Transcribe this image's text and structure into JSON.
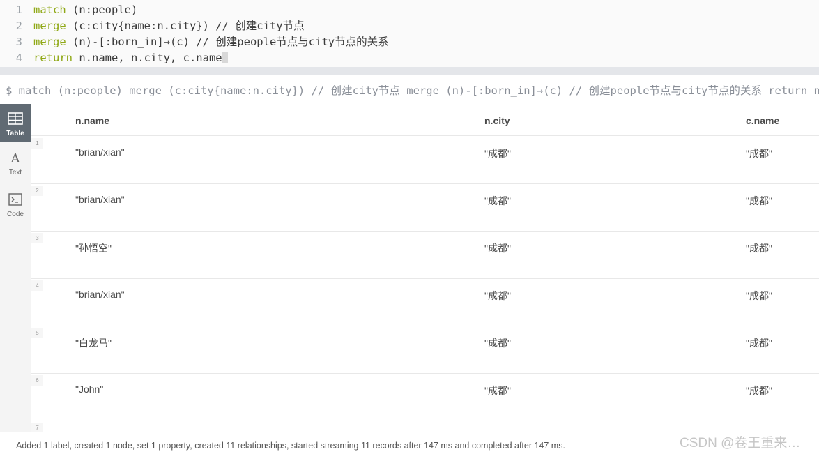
{
  "editor": {
    "lines": [
      {
        "num": "1",
        "kw": "match",
        "rest": " (n:people)"
      },
      {
        "num": "2",
        "kw": "merge",
        "rest": " (c:city{name:n.city}) // 创建city节点"
      },
      {
        "num": "3",
        "kw": "merge",
        "rest": " (n)-[:born_in]→(c) // 创建people节点与city节点的关系"
      },
      {
        "num": "4",
        "kw": "return",
        "rest": " n.name, n.city, c.name"
      }
    ]
  },
  "summary": {
    "text": "$ match (n:people) merge (c:city{name:n.city}) // 创建city节点 merge (n)-[:born_in]→(c) // 创建people节点与city节点的关系 return n.n"
  },
  "sidebar": {
    "tabs": [
      {
        "label": "Table",
        "icon": "table-icon",
        "active": true
      },
      {
        "label": "Text",
        "icon": "text-icon",
        "active": false
      },
      {
        "label": "Code",
        "icon": "code-icon",
        "active": false
      }
    ]
  },
  "table": {
    "columns": [
      "n.name",
      "n.city",
      "c.name"
    ],
    "rows": [
      {
        "num": "1",
        "cells": [
          "\"brian/xian\"",
          "\"成都\"",
          "\"成都\""
        ]
      },
      {
        "num": "2",
        "cells": [
          "\"brian/xian\"",
          "\"成都\"",
          "\"成都\""
        ]
      },
      {
        "num": "3",
        "cells": [
          "\"孙悟空\"",
          "\"成都\"",
          "\"成都\""
        ]
      },
      {
        "num": "4",
        "cells": [
          "\"brian/xian\"",
          "\"成都\"",
          "\"成都\""
        ]
      },
      {
        "num": "5",
        "cells": [
          "\"白龙马\"",
          "\"成都\"",
          "\"成都\""
        ]
      },
      {
        "num": "6",
        "cells": [
          "\"John\"",
          "\"成都\"",
          "\"成都\""
        ]
      },
      {
        "num": "7",
        "cells": [
          "",
          "",
          ""
        ]
      }
    ]
  },
  "status": {
    "text": "Added 1 label, created 1 node, set 1 property, created 11 relationships, started streaming 11 records after 147 ms and completed after 147 ms."
  },
  "watermark": "CSDN @卷王重来…",
  "colors": {
    "keyword": "#8fa815",
    "active_tab": "#606a73"
  }
}
